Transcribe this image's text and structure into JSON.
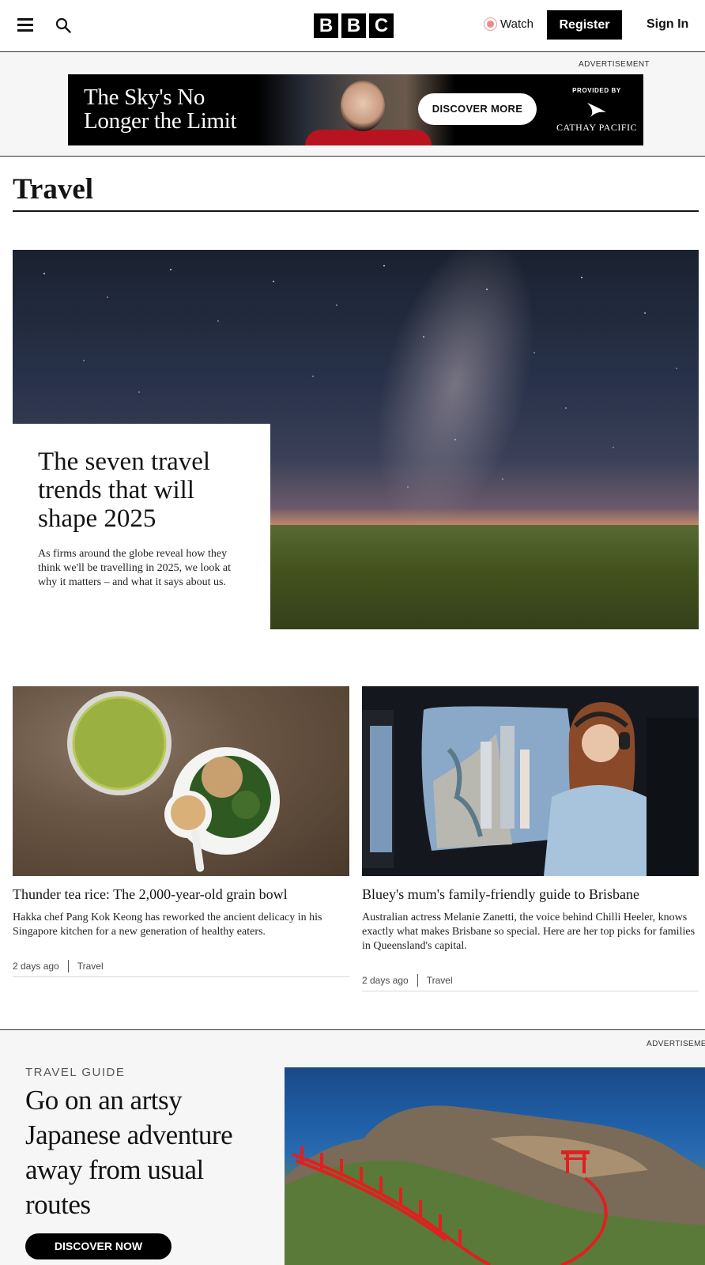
{
  "header": {
    "logo": [
      "B",
      "B",
      "C"
    ],
    "watch_label": "Watch",
    "register_label": "Register",
    "signin_label": "Sign In"
  },
  "ad_top": {
    "label": "ADVERTISEMENT",
    "headline_line1": "The Sky's No",
    "headline_line2": "Longer the Limit",
    "cta": "DISCOVER MORE",
    "provided_by": "PROVIDED BY",
    "brand": "CATHAY PACIFIC"
  },
  "section": {
    "title": "Travel"
  },
  "hero": {
    "title": "The seven travel trends that will shape 2025",
    "description": "As firms around the globe reveal how they think we'll be travelling in 2025, we look at why it matters – and what it says about us."
  },
  "cards": [
    {
      "title": "Thunder tea rice: The 2,000-year-old grain bowl",
      "description": "Hakka chef Pang Kok Keong has reworked the ancient delicacy in his Singapore kitchen for a new generation of healthy eaters.",
      "time": "2 days ago",
      "category": "Travel"
    },
    {
      "title": "Bluey's mum's family-friendly guide to Brisbane",
      "description": "Australian actress Melanie Zanetti, the voice behind Chilli Heeler, knows exactly what makes Brisbane so special. Here are her top picks for families in Queensland's capital.",
      "time": "2 days ago",
      "category": "Travel"
    }
  ],
  "ad_bottom": {
    "label": "ADVERTISEMENT",
    "kicker": "TRAVEL GUIDE",
    "title": "Go on an artsy Japanese adventure away from usual routes",
    "cta": "DISCOVER NOW"
  }
}
